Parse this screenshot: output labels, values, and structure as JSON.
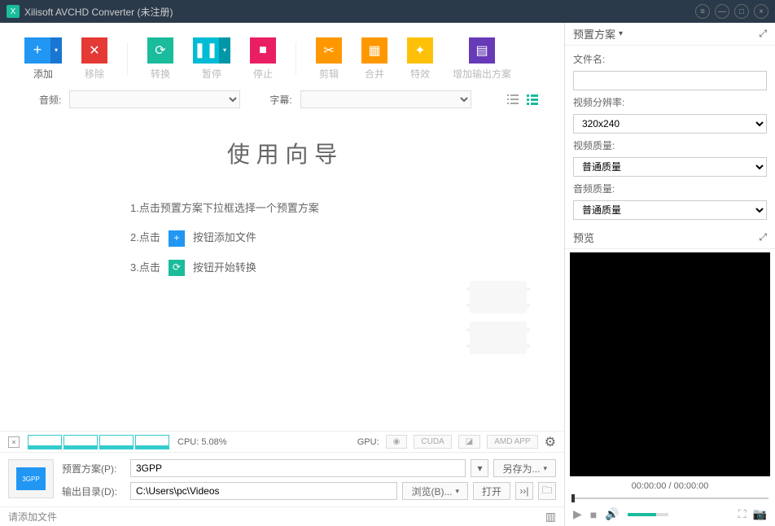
{
  "titlebar": {
    "title": "Xilisoft AVCHD Converter (未注册)"
  },
  "toolbar": {
    "add": "添加",
    "remove": "移除",
    "convert": "转换",
    "pause": "暂停",
    "stop": "停止",
    "clip": "剪辑",
    "merge": "合并",
    "effects": "特效",
    "add_output": "增加输出方案"
  },
  "subtoolbar": {
    "audio_label": "音频:",
    "subtitle_label": "字幕:"
  },
  "wizard": {
    "title": "使 用 向 导",
    "step1": "1.点击预置方案下拉框选择一个预置方案",
    "step2_a": "2.点击",
    "step2_b": "按钮添加文件",
    "step3_a": "3.点击",
    "step3_b": "按钮开始转换"
  },
  "cpu": {
    "label": "CPU: 5.08%",
    "gpu_label": "GPU:",
    "cuda": "CUDA",
    "amd": "AMD APP"
  },
  "bottom": {
    "preset_label": "预置方案(P):",
    "preset_value": "3GPP",
    "save_as": "另存为...",
    "output_label": "输出目录(D):",
    "output_value": "C:\\Users\\pc\\Videos",
    "browse": "浏览(B)...",
    "open": "打开",
    "thumb_text": "3GPP"
  },
  "status": {
    "hint": "请添加文件"
  },
  "preset_panel": {
    "header": "预置方案",
    "filename_label": "文件名:",
    "resolution_label": "视频分辨率:",
    "resolution_value": "320x240",
    "video_quality_label": "视频质量:",
    "video_quality_value": "普通质量",
    "audio_quality_label": "音频质量:",
    "audio_quality_value": "普通质量"
  },
  "preview_panel": {
    "header": "预览",
    "time": "00:00:00 / 00:00:00"
  }
}
